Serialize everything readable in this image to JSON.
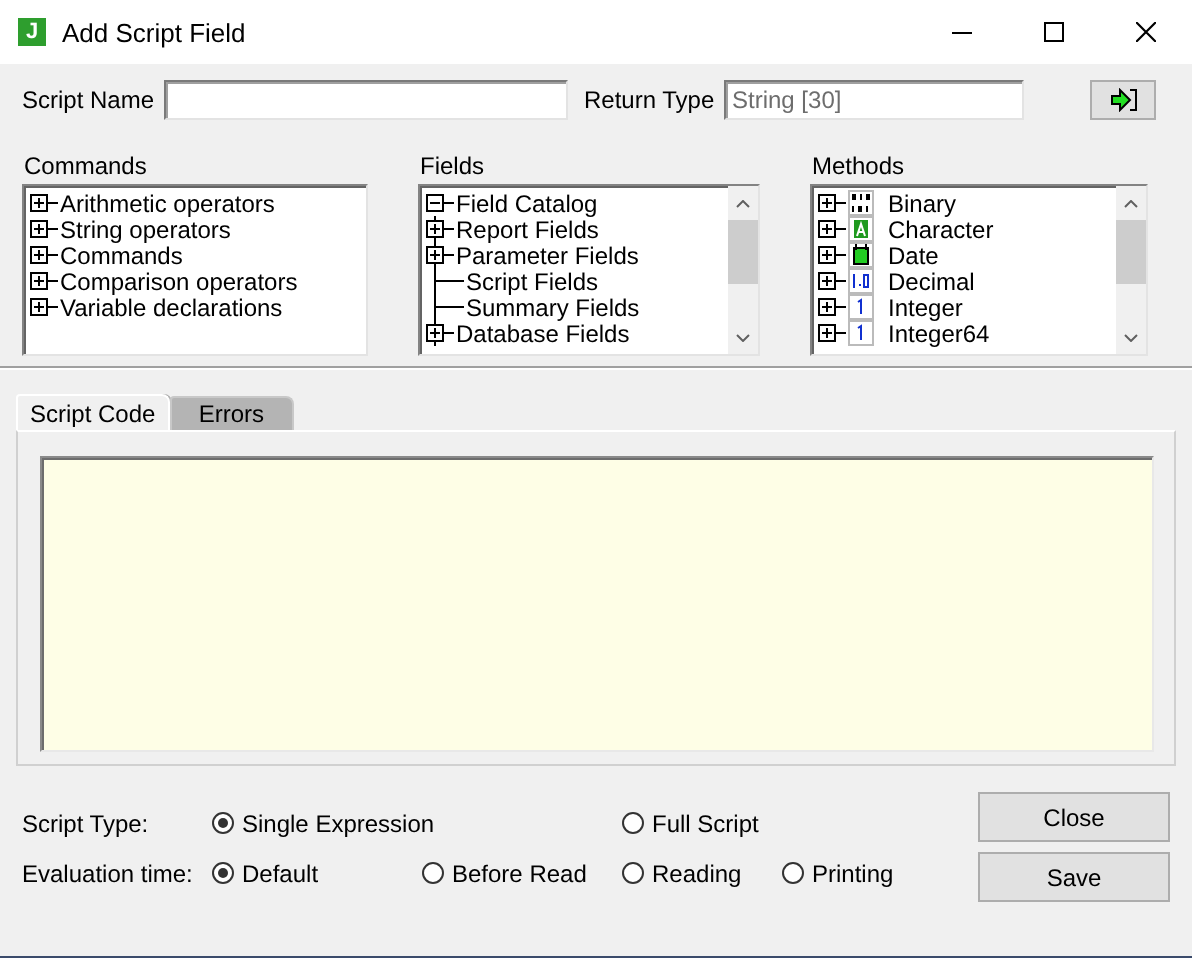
{
  "window": {
    "app_icon": "J",
    "title": "Add Script Field"
  },
  "script_name": {
    "label": "Script Name"
  },
  "return_type": {
    "label": "Return Type",
    "value": "String [30]"
  },
  "commands": {
    "label": "Commands",
    "items": [
      {
        "label": "Arithmetic operators",
        "expanded": false
      },
      {
        "label": "String operators",
        "expanded": false
      },
      {
        "label": "Commands",
        "expanded": false
      },
      {
        "label": "Comparison operators",
        "expanded": false
      },
      {
        "label": "Variable declarations",
        "expanded": false
      }
    ]
  },
  "fields": {
    "label": "Fields",
    "items": [
      {
        "label": "Field Catalog",
        "expanded": true,
        "children": [
          {
            "label": "Report Fields",
            "expanded": false
          },
          {
            "label": "Parameter Fields",
            "expanded": false
          },
          {
            "label": "Script Fields"
          },
          {
            "label": "Summary Fields"
          },
          {
            "label": "Database Fields",
            "expanded": false
          }
        ]
      }
    ]
  },
  "methods": {
    "label": "Methods",
    "items": [
      {
        "label": "Binary",
        "kind": "binary",
        "expanded": false
      },
      {
        "label": "Character",
        "kind": "character",
        "expanded": false
      },
      {
        "label": "Date",
        "kind": "date",
        "expanded": false
      },
      {
        "label": "Decimal",
        "kind": "decimal",
        "expanded": false
      },
      {
        "label": "Integer",
        "kind": "integer",
        "expanded": false
      },
      {
        "label": "Integer64",
        "kind": "integer",
        "expanded": false
      }
    ]
  },
  "tabs": [
    {
      "label": "Script Code",
      "selected": true
    },
    {
      "label": "Errors",
      "selected": false
    }
  ],
  "script_type": {
    "label": "Script Type:",
    "options": [
      {
        "label": "Single Expression",
        "selected": true
      },
      {
        "label": "Full Script",
        "selected": false
      }
    ]
  },
  "evaluation_time": {
    "label": "Evaluation time:",
    "options": [
      {
        "label": "Default",
        "selected": true
      },
      {
        "label": "Before Read",
        "selected": false
      },
      {
        "label": "Reading",
        "selected": false
      },
      {
        "label": "Printing",
        "selected": false
      }
    ]
  },
  "buttons": [
    "Close",
    "Save"
  ]
}
